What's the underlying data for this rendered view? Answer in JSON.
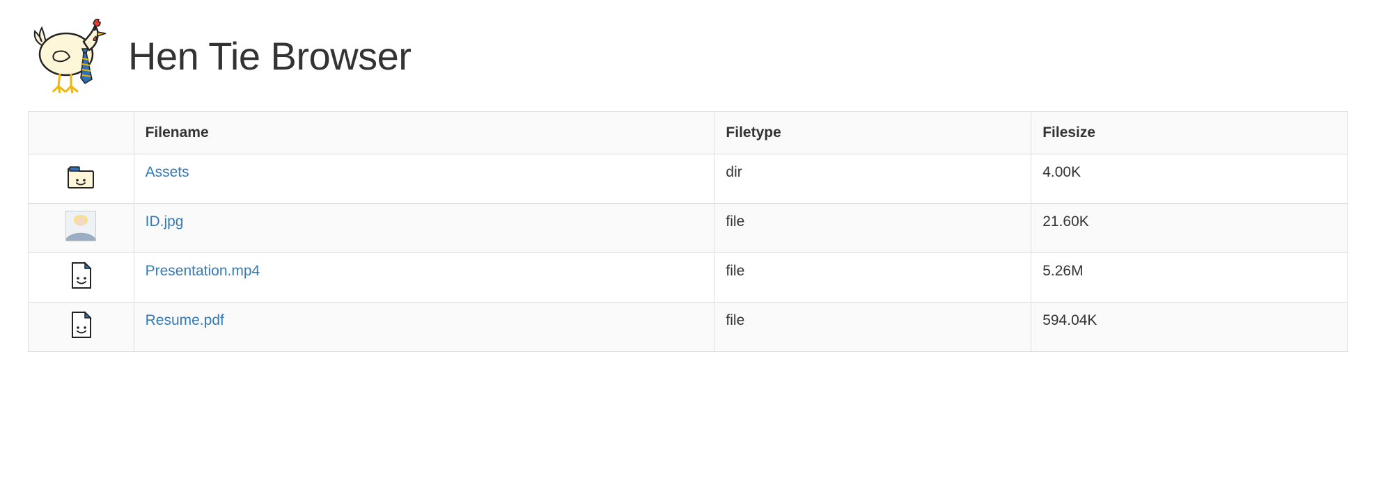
{
  "header": {
    "title": "Hen Tie Browser"
  },
  "table": {
    "headers": {
      "filename": "Filename",
      "filetype": "Filetype",
      "filesize": "Filesize"
    },
    "rows": [
      {
        "icon": "folder-icon",
        "name": "Assets",
        "type": "dir",
        "size": "4.00K"
      },
      {
        "icon": "photo-thumb",
        "name": "ID.jpg",
        "type": "file",
        "size": "21.60K"
      },
      {
        "icon": "file-icon",
        "name": "Presentation.mp4",
        "type": "file",
        "size": "5.26M"
      },
      {
        "icon": "file-icon",
        "name": "Resume.pdf",
        "type": "file",
        "size": "594.04K"
      }
    ]
  }
}
